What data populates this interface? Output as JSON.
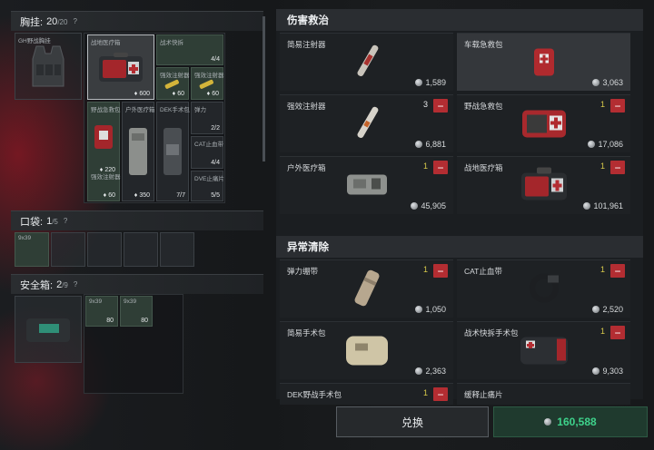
{
  "left": {
    "vest": {
      "label": "胸挂:",
      "count": "20",
      "max": "/20",
      "help": "?"
    },
    "vest_item": {
      "label": "GH野战胸挂"
    },
    "pouch": {
      "label": "口袋:",
      "count": "1",
      "max": "/5",
      "help": "?"
    },
    "pouch_item": {
      "label": "9x39"
    },
    "safe": {
      "label": "安全箱:",
      "count": "2",
      "max": "/9",
      "help": "?"
    },
    "slots": [
      {
        "label": "战地医疗箱",
        "value": "600"
      },
      {
        "label": "战术快拆",
        "stack": "4/4"
      },
      {
        "label": "强效注射器",
        "value": "60"
      },
      {
        "label": "强效注射器",
        "value": "60"
      },
      {
        "label": "野战急救包",
        "value": "220"
      },
      {
        "label": "户外医疗箱",
        "value": "350"
      },
      {
        "label": "DEK手术包",
        "stack": "7/7"
      },
      {
        "label": "弹力",
        "stack": "2/2"
      },
      {
        "label": "CAT止血带",
        "stack": "4/4"
      },
      {
        "label": "DVE止痛片",
        "stack": "5/5"
      },
      {
        "label": "强效注射器",
        "value": "60"
      }
    ],
    "safe_items": [
      {
        "label": "9x39",
        "value": "80"
      },
      {
        "label": "9x39",
        "value": "80"
      }
    ]
  },
  "right": {
    "category1": "伤害救治",
    "category2": "异常清除",
    "items1": [
      {
        "name": "简易注射器",
        "qty": "",
        "price": "1,589"
      },
      {
        "name": "车载急救包",
        "qty": "",
        "price": "3,063"
      },
      {
        "name": "强效注射器",
        "qty": "3",
        "price": "6,881"
      },
      {
        "name": "野战急救包",
        "qty": "1",
        "price": "17,086"
      },
      {
        "name": "户外医疗箱",
        "qty": "1",
        "price": "45,905"
      },
      {
        "name": "战地医疗箱",
        "qty": "1",
        "price": "101,961"
      }
    ],
    "items2": [
      {
        "name": "弹力绷带",
        "qty": "1",
        "price": "1,050"
      },
      {
        "name": "CAT止血带",
        "qty": "1",
        "price": "2,520"
      },
      {
        "name": "简易手术包",
        "qty": "",
        "price": "2,363"
      },
      {
        "name": "战术快拆手术包",
        "qty": "1",
        "price": "9,303"
      },
      {
        "name": "DEK野战手术包",
        "qty": "1",
        "price": ""
      },
      {
        "name": "缓释止痛片",
        "qty": "",
        "price": ""
      }
    ]
  },
  "footer": {
    "exchange": "兑换",
    "total": "160,588"
  },
  "colors": {
    "accent_green": "#3ed28b",
    "minus_red": "#b32d32",
    "qty_yellow": "#d6c84a"
  }
}
